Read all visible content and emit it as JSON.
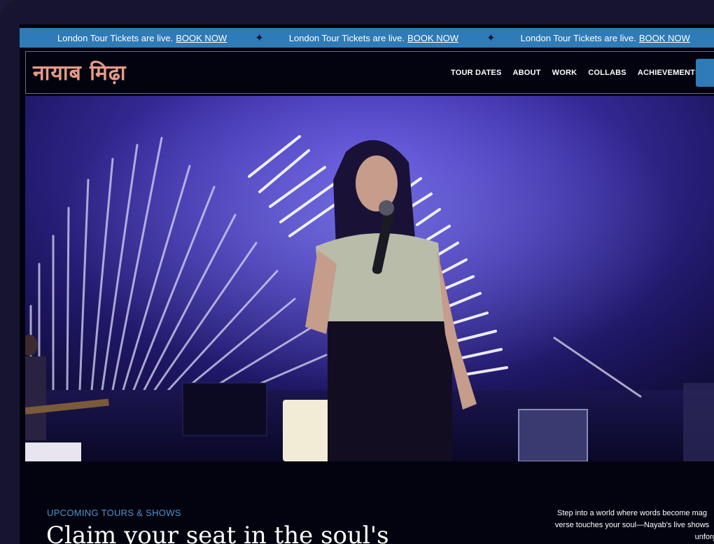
{
  "ticker": {
    "items": [
      {
        "text": "London Tour Tickets are live.",
        "link": "BOOK NOW"
      },
      {
        "text": "London Tour Tickets are live.",
        "link": "BOOK NOW"
      },
      {
        "text": "London Tour Tickets are live.",
        "link": "BOOK NOW"
      }
    ],
    "separator_icon": "sparkle-star-icon",
    "background": "#2e7bb8"
  },
  "header": {
    "logo_text": "नायाब मिढ़ा",
    "logo_color": "#e89b88",
    "nav": [
      "TOUR DATES",
      "ABOUT",
      "WORK",
      "COLLABS",
      "ACHIEVEMENTS"
    ]
  },
  "hero": {
    "media": "concert-stage-photo"
  },
  "intro": {
    "eyebrow": "UPCOMING TOURS & SHOWS",
    "headline": "Claim your seat in the soul's",
    "blurb_lines": [
      "Step into a world where words become mag",
      "verse touches your soul—Nayab's live shows",
      "unforgett"
    ],
    "accent": "#4d93d0"
  }
}
